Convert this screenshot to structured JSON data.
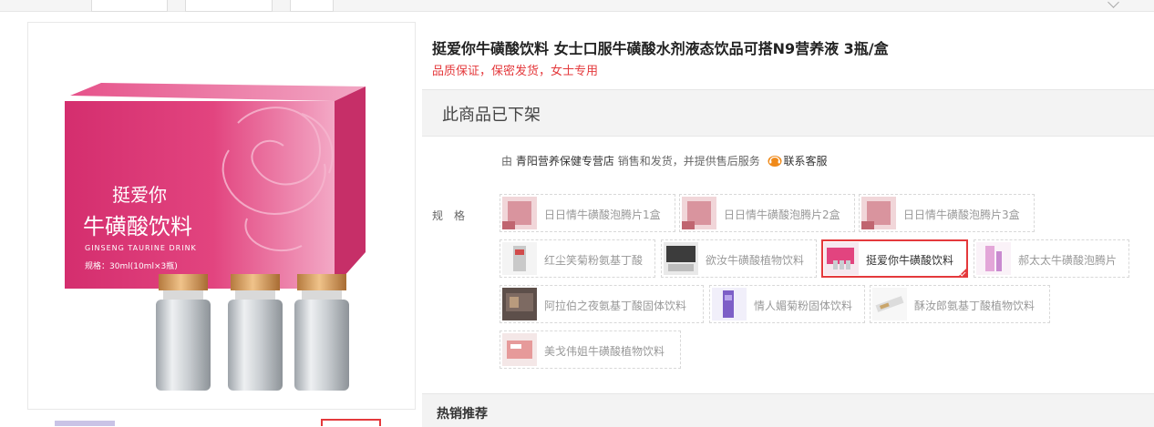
{
  "product": {
    "title": "挺爱你牛磺酸饮料 女士口服牛磺酸水剂液态饮品可搭N9营养液 3瓶/盒",
    "subtitle": "品质保证，保密发货，女士专用",
    "status": "此商品已下架"
  },
  "seller": {
    "prefix": "由",
    "store": "青阳营养保健专营店",
    "middle": "销售和发货，并提供售后服务",
    "cs_label": "联系客服",
    "cs_icon": "customer-service-icon"
  },
  "spec": {
    "label": "规格",
    "options": [
      {
        "label": "日日情牛磺酸泡腾片1盒",
        "selected": false
      },
      {
        "label": "日日情牛磺酸泡腾片2盒",
        "selected": false
      },
      {
        "label": "日日情牛磺酸泡腾片3盒",
        "selected": false
      },
      {
        "label": "红尘笑菊粉氨基丁酸",
        "selected": false
      },
      {
        "label": "欲汝牛磺酸植物饮料",
        "selected": false
      },
      {
        "label": "挺爱你牛磺酸饮料",
        "selected": true
      },
      {
        "label": "郝太太牛磺酸泡腾片",
        "selected": false
      },
      {
        "label": "阿拉伯之夜氨基丁酸固体饮料",
        "selected": false
      },
      {
        "label": "情人媚菊粉固体饮料",
        "selected": false
      },
      {
        "label": "酥汝郎氨基丁酸植物饮料",
        "selected": false
      },
      {
        "label": "美戈伟姐牛磺酸植物饮料",
        "selected": false
      }
    ]
  },
  "image": {
    "box_brand": "挺爱你",
    "box_name": "牛磺酸饮料",
    "box_english": "GINSENG TAURINE DRINK",
    "box_spec": "规格：30ml(10ml×3瓶)"
  },
  "hot": {
    "label": "热销推荐"
  },
  "colors": {
    "accent": "#e4393c",
    "box_pink": "#e2447f"
  }
}
